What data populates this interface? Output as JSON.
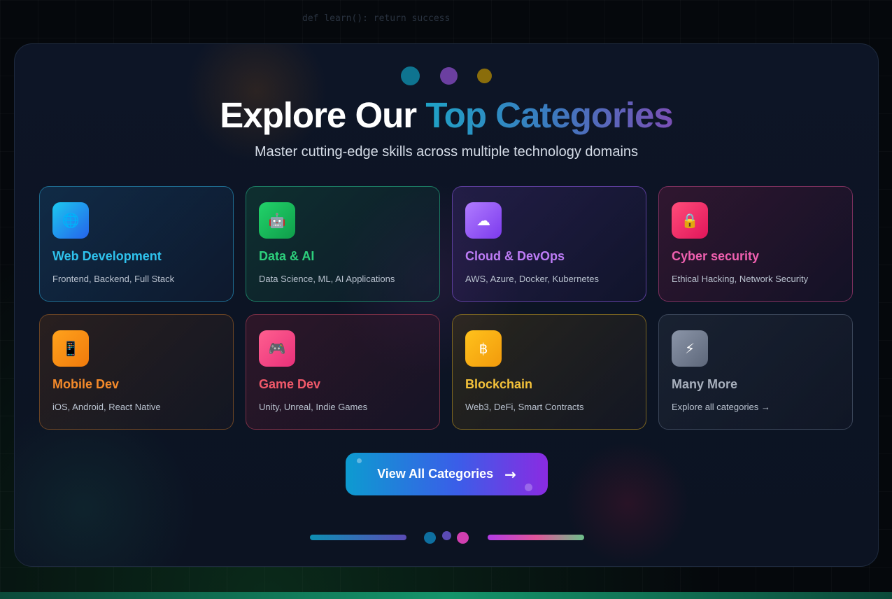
{
  "background": {
    "code_snippet": "def learn(): return success"
  },
  "header": {
    "title_plain": "Explore Our ",
    "title_highlight": "Top Categories",
    "subtitle": "Master cutting-edge skills across multiple technology domains"
  },
  "categories": [
    {
      "icon": "globe-icon",
      "glyph": "🌐",
      "name": "Web Development",
      "desc": "Frontend, Backend, Full Stack",
      "color": "#2fc3ee"
    },
    {
      "icon": "robot-icon",
      "glyph": "🤖",
      "name": "Data & AI",
      "desc": "Data Science, ML, AI Applications",
      "color": "#2dd07c"
    },
    {
      "icon": "cloud-icon",
      "glyph": "☁",
      "name": "Cloud & DevOps",
      "desc": "AWS, Azure, Docker, Kubernetes",
      "color": "#bd7cf6"
    },
    {
      "icon": "lock-icon",
      "glyph": "🔒",
      "name": "Cyber security",
      "desc": "Ethical Hacking, Network Security",
      "color": "#f060b0"
    },
    {
      "icon": "mobile-phone-icon",
      "glyph": "📱",
      "name": "Mobile Dev",
      "desc": "iOS, Android, React Native",
      "color": "#f48a2a"
    },
    {
      "icon": "game-controller-icon",
      "glyph": "🎮",
      "name": "Game Dev",
      "desc": "Unity, Unreal, Indie Games",
      "color": "#f2596a"
    },
    {
      "icon": "bitcoin-icon",
      "glyph": "฿",
      "name": "Blockchain",
      "desc": "Web3, DeFi, Smart Contracts",
      "color": "#f4c23a"
    },
    {
      "icon": "lightning-icon",
      "glyph": "⚡",
      "name": "Many More",
      "desc": "Explore all categories →",
      "color": "#a8b0bd"
    }
  ],
  "cta": {
    "label": "View All Categories",
    "arrow": "→"
  }
}
